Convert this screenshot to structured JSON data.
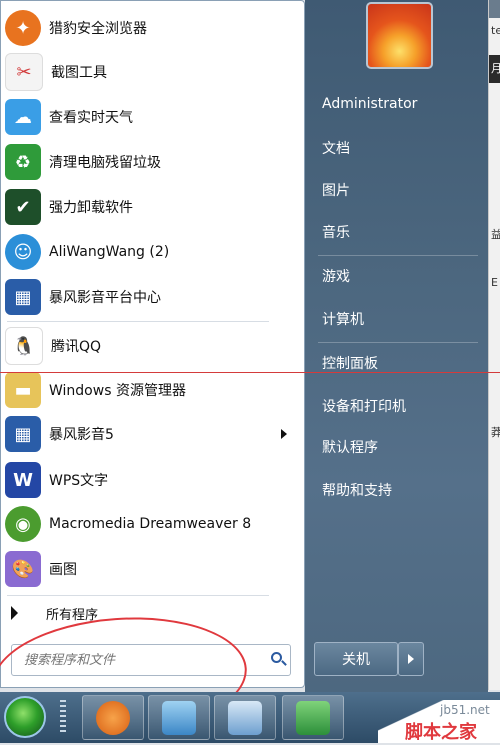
{
  "background_window": {
    "fragments": [
      "te",
      "月",
      "益",
      "E",
      "莽"
    ]
  },
  "left_items": [
    {
      "label": "猎豹安全浏览器",
      "icon": "cheetah-browser-icon",
      "color": "#e8731f"
    },
    {
      "label": "截图工具",
      "icon": "scissors-icon",
      "color": "#d23b3b"
    },
    {
      "label": "查看实时天气",
      "icon": "weather-cloud-icon",
      "color": "#3a9ee6"
    },
    {
      "label": "清理电脑残留垃圾",
      "icon": "recycle-bin-icon",
      "color": "#2f9b3a"
    },
    {
      "label": "强力卸载软件",
      "icon": "uninstall-shield-icon",
      "color": "#1e4f2a"
    },
    {
      "label": "AliWangWang (2)",
      "icon": "aliwangwang-icon",
      "color": "#2b8fd8"
    },
    {
      "label": "暴风影音平台中心",
      "icon": "film-strip-icon",
      "color": "#2a5da8"
    },
    {
      "label": "腾讯QQ",
      "icon": "qq-penguin-icon",
      "color": "#222222"
    },
    {
      "label": "Windows 资源管理器",
      "icon": "folder-explorer-icon",
      "color": "#e7c45a"
    },
    {
      "label": "暴风影音5",
      "icon": "film-strip-icon",
      "color": "#2a5da8"
    },
    {
      "label": "WPS文字",
      "icon": "wps-writer-icon",
      "color": "#2447a5"
    },
    {
      "label": "Macromedia Dreamweaver 8",
      "icon": "dreamweaver-icon",
      "color": "#4b9c2f"
    },
    {
      "label": "画图",
      "icon": "paint-palette-icon",
      "color": "#8a6bd1"
    }
  ],
  "all_programs_label": "所有程序",
  "search": {
    "placeholder": "搜索程序和文件"
  },
  "right_items": [
    "Administrator",
    "文档",
    "图片",
    "音乐",
    "游戏",
    "计算机",
    "控制面板",
    "设备和打印机",
    "默认程序",
    "帮助和支持"
  ],
  "shutdown_label": "关机",
  "watermark": {
    "line1": "jb51.net",
    "line2": "脚本之家"
  },
  "colors": {
    "accent_red": "#e0393e",
    "right_panel": "#4c677f"
  }
}
